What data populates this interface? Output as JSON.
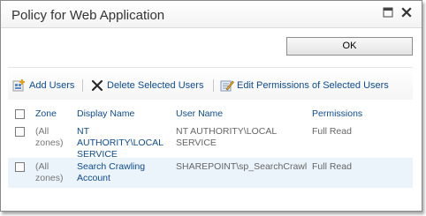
{
  "dialog": {
    "title": "Policy for Web Application",
    "ok_label": "OK"
  },
  "toolbar": {
    "add_users": "Add Users",
    "delete_selected_users": "Delete Selected Users",
    "edit_permissions": "Edit Permissions of Selected Users"
  },
  "table": {
    "columns": [
      "Zone",
      "Display Name",
      "User Name",
      "Permissions"
    ],
    "rows": [
      {
        "zone_line1": "(All",
        "zone_line2": "zones)",
        "display_line1": "NT",
        "display_line2": "AUTHORITY\\LOCAL",
        "display_line3": "SERVICE",
        "user_line1": "NT AUTHORITY\\LOCAL",
        "user_line2": "SERVICE",
        "permissions": "Full Read"
      },
      {
        "zone_line1": "(All",
        "zone_line2": "zones)",
        "display_line1": "Search Crawling",
        "display_line2": "Account",
        "user_line1": "SHAREPOINT\\sp_SearchCrawl",
        "permissions": "Full Read"
      }
    ]
  },
  "colors": {
    "link": "#0e4b8c",
    "selected_row": "#ebf3fb"
  },
  "icons": [
    "maximize-icon",
    "close-icon",
    "add-users-icon",
    "delete-icon",
    "edit-permissions-icon"
  ]
}
